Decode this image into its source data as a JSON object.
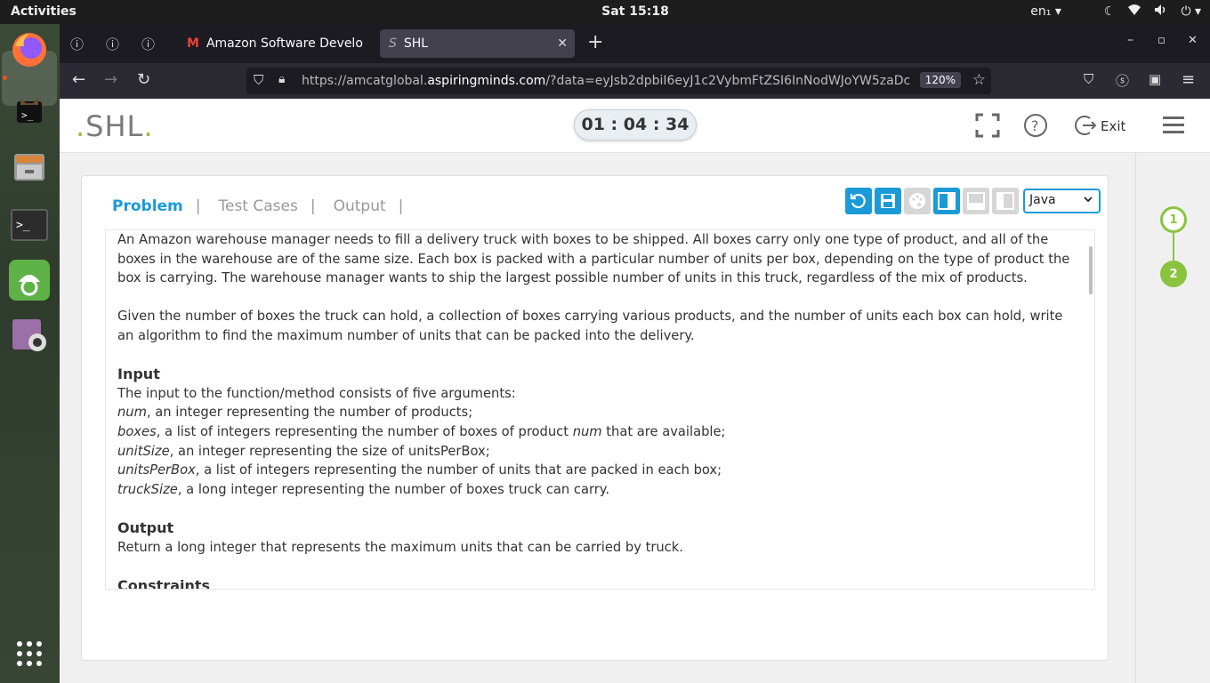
{
  "system": {
    "activities": "Activities",
    "clock": "Sat 15:18",
    "lang": "en₁"
  },
  "browser": {
    "tabs": [
      {
        "title": "Amazon Software Develo",
        "favicon": "gmail-icon"
      },
      {
        "title": "SHL",
        "favicon": "shl-icon"
      }
    ],
    "url_prefix": "https://amcatglobal.",
    "url_domain": "aspiringminds.com",
    "url_suffix": "/?data=eyJsb2dpbiI6eyJ1c2VybmFtZSI6InNodWJoYW5zaDc",
    "zoom": "120%"
  },
  "header": {
    "logo": "SHL",
    "timer": "01 : 04 : 34",
    "exit": "Exit"
  },
  "panel": {
    "tabs": [
      "Problem",
      "Test Cases",
      "Output"
    ],
    "language": "Java"
  },
  "problem": {
    "p1": "An Amazon warehouse manager needs to fill a delivery truck with boxes to be shipped. All boxes carry only one type of product, and all of the boxes in the warehouse are of the same size. Each box is packed with a particular number of units per box, depending on the type of product the box is carrying. The warehouse manager wants to ship the largest possible number of units in this truck, regardless of the mix of products.",
    "p2": "Given the number of boxes the truck can hold, a collection of boxes carrying various products, and the number of units each box can hold, write an algorithm to find the maximum number of units that can be packed into the delivery.",
    "input_heading": "Input",
    "input_intro": "The input to the function/method consists of five arguments:",
    "args": [
      {
        "name": "num",
        "desc": ", an integer representing the number of products;"
      },
      {
        "name": "boxes",
        "desc": ", a list of integers representing the number of boxes of product ",
        "extra_italic": "num",
        "tail": " that are available;"
      },
      {
        "name": "unitSize",
        "desc": ", an integer representing the size of unitsPerBox;"
      },
      {
        "name": "unitsPerBox",
        "desc": ", a list of integers representing the number of units that are packed in each box;"
      },
      {
        "name": "truckSize",
        "desc": ", a long integer representing the number of boxes truck can carry."
      }
    ],
    "output_heading": "Output",
    "output_text": "Return a long integer that represents the maximum units that can be carried by truck.",
    "constraints_heading": "Constraints"
  },
  "steps": [
    "1",
    "2"
  ],
  "colors": {
    "accent": "#1a9bd7",
    "green": "#8ac43f"
  }
}
